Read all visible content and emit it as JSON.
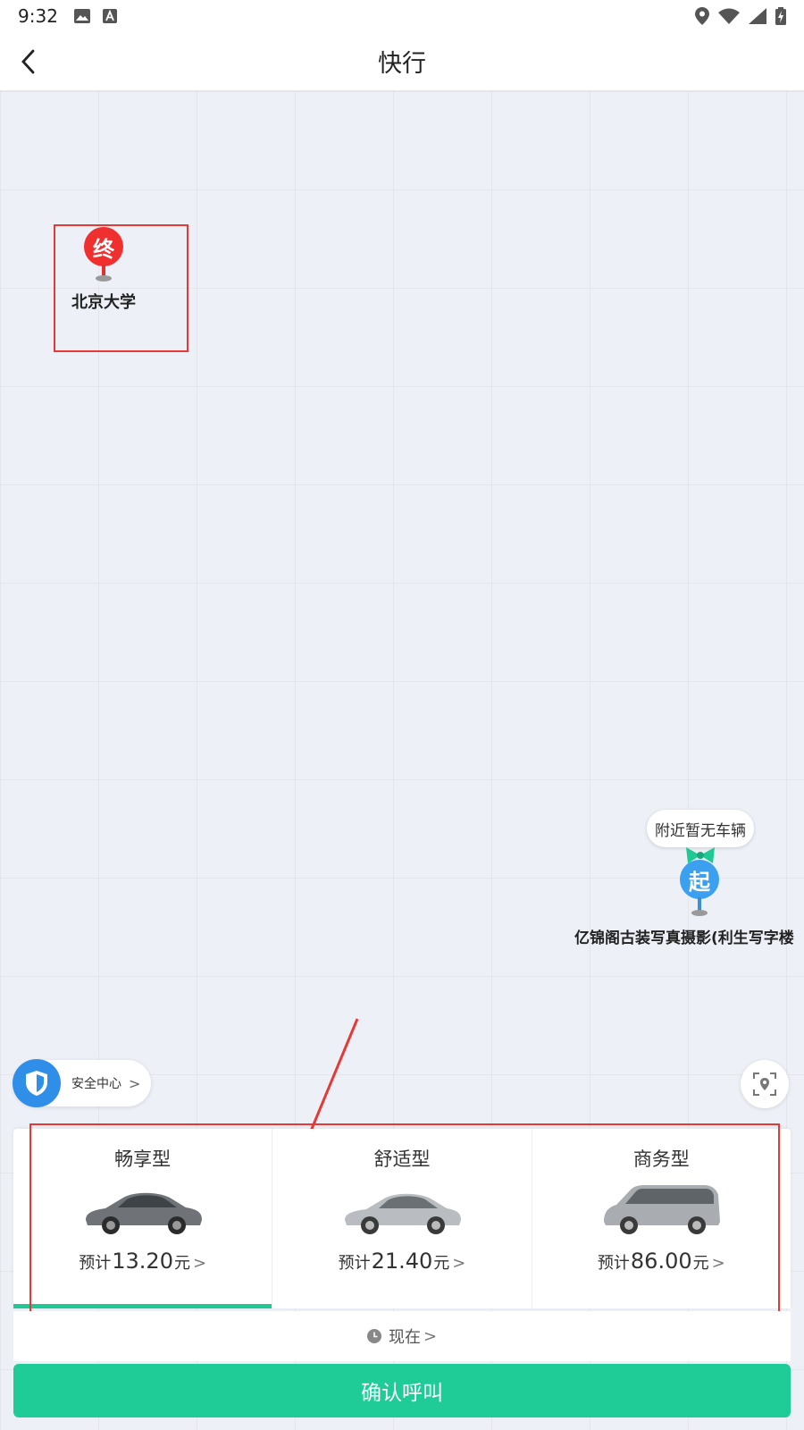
{
  "status_bar": {
    "time": "9:32"
  },
  "nav": {
    "title": "快行"
  },
  "map": {
    "destination": {
      "badge": "终",
      "label": "北京大学"
    },
    "start": {
      "badge": "起",
      "label": "亿锦阁古装写真摄影(利生写字楼",
      "bubble": "附近暂无车辆"
    }
  },
  "safety": {
    "label": "安全中心"
  },
  "cars": [
    {
      "name": "畅享型",
      "prefix": "预计",
      "price": "13.20",
      "unit": "元",
      "selected": true
    },
    {
      "name": "舒适型",
      "prefix": "预计",
      "price": "21.40",
      "unit": "元",
      "selected": false
    },
    {
      "name": "商务型",
      "prefix": "预计",
      "price": "86.00",
      "unit": "元",
      "selected": false
    }
  ],
  "time_selector": {
    "label": "现在"
  },
  "confirm": {
    "label": "确认呼叫"
  },
  "colors": {
    "accent": "#1fcc98",
    "destination": "#f02f2f",
    "start": "#3aa0ef",
    "annotation": "#e53935"
  }
}
